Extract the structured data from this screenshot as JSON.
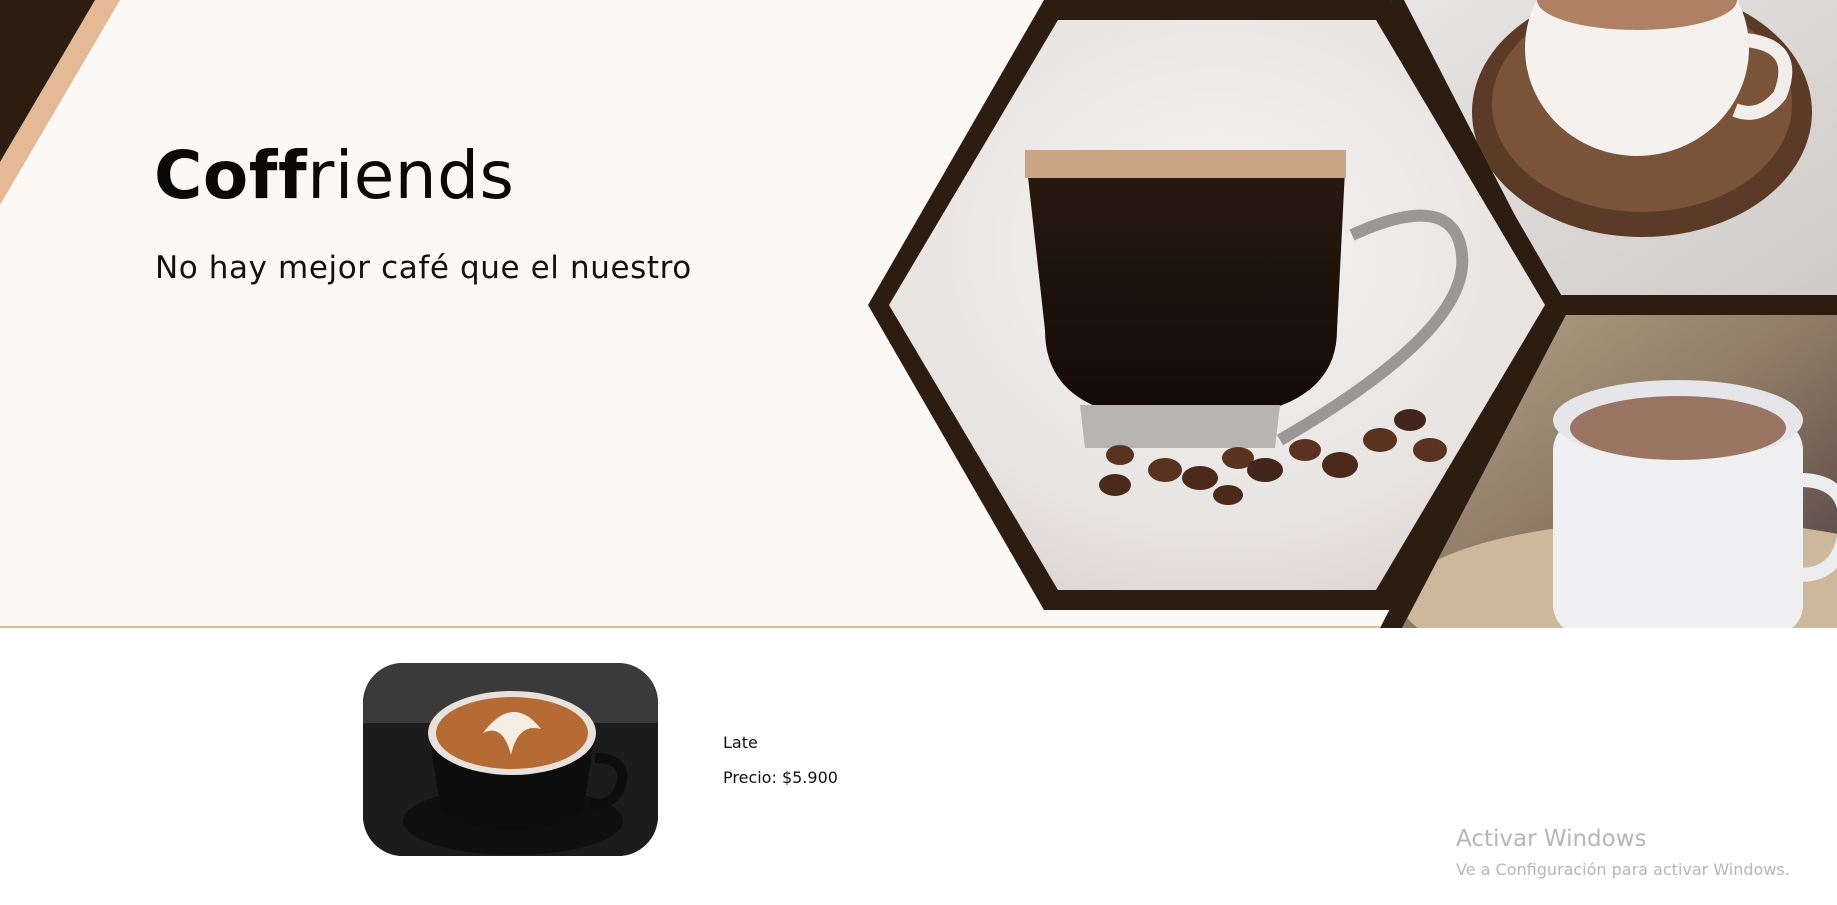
{
  "hero": {
    "brand_bold": "Coff",
    "brand_rest": "riends",
    "tagline": "No hay mejor café que el nuestro",
    "images": [
      {
        "icon": "espresso-glass-cup-with-coffee-beans"
      },
      {
        "icon": "coffee-cup-on-wooden-saucer"
      },
      {
        "icon": "hot-chocolate-white-mug"
      }
    ]
  },
  "product": {
    "image_icon": "latte-art-cup",
    "name": "Late",
    "price": "Precio: $5.900"
  },
  "os_watermark": {
    "title": "Activar Windows",
    "subtitle": "Ve a Configuración para activar Windows."
  },
  "colors": {
    "hero_background": "#fcf8f6",
    "dark_brown": "#2d1d11",
    "accent_tan": "#e4b996"
  }
}
